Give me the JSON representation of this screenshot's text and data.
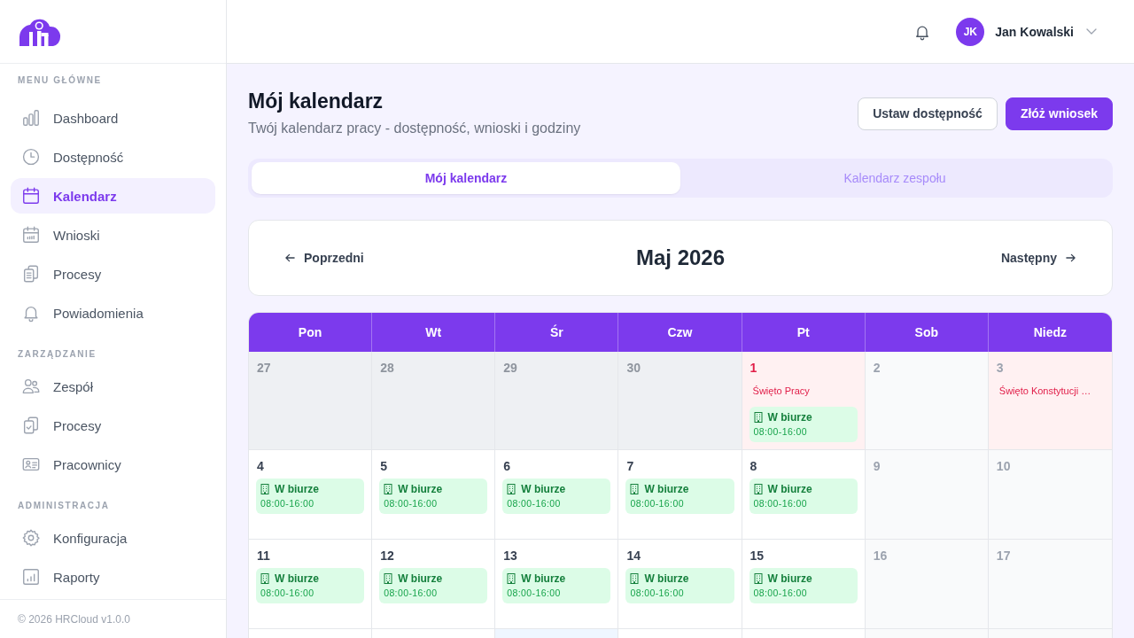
{
  "sidebar": {
    "sections": [
      {
        "title": "MENU GŁÓWNE",
        "items": [
          {
            "label": "Dashboard",
            "selected": false
          },
          {
            "label": "Dostępność",
            "selected": false
          },
          {
            "label": "Kalendarz",
            "selected": true
          },
          {
            "label": "Wnioski",
            "selected": false
          },
          {
            "label": "Procesy",
            "selected": false
          },
          {
            "label": "Powiadomienia",
            "selected": false
          }
        ]
      },
      {
        "title": "ZARZĄDZANIE",
        "items": [
          {
            "label": "Zespół",
            "selected": false
          },
          {
            "label": "Procesy",
            "selected": false
          },
          {
            "label": "Pracownicy",
            "selected": false
          }
        ]
      },
      {
        "title": "ADMINISTRACJA",
        "items": [
          {
            "label": "Konfiguracja",
            "selected": false
          },
          {
            "label": "Raporty",
            "selected": false
          }
        ]
      }
    ],
    "footer": "© 2026 HRCloud v1.0.0"
  },
  "top_bar": {
    "user": {
      "initials": "JK",
      "name": "Jan Kowalski"
    }
  },
  "page": {
    "title": "Mój kalendarz",
    "subtitle": "Twój kalendarz pracy - dostępność, wnioski i godziny",
    "buttons": [
      {
        "label": "Ustaw dostępność",
        "kind": "secondary"
      },
      {
        "label": "Złóż wniosek",
        "kind": "primary"
      }
    ]
  },
  "tabs": [
    {
      "label": "Mój kalendarz",
      "selected": true
    },
    {
      "label": "Kalendarz zespołu",
      "selected": false
    }
  ],
  "month_nav": {
    "previous": "Poprzedni",
    "title": "Maj 2026",
    "next": "Następny"
  },
  "calendar": {
    "weekdays": [
      "Pon",
      "Wt",
      "Śr",
      "Czw",
      "Pt",
      "Sob",
      "Niedz"
    ],
    "weeks": [
      [
        {
          "day": "27",
          "kind": "outside"
        },
        {
          "day": "28",
          "kind": "outside"
        },
        {
          "day": "29",
          "kind": "outside"
        },
        {
          "day": "30",
          "kind": "outside"
        },
        {
          "day": "1",
          "kind": "workday",
          "holiday": "Święto Pracy",
          "events": [
            {
              "title": "W biurze",
              "time": "08:00-16:00"
            }
          ]
        },
        {
          "day": "2",
          "kind": "weekend"
        },
        {
          "day": "3",
          "kind": "weekend",
          "holiday": "Święto Konstytucji …"
        }
      ],
      [
        {
          "day": "4",
          "kind": "workday",
          "events": [
            {
              "title": "W biurze",
              "time": "08:00-16:00"
            }
          ]
        },
        {
          "day": "5",
          "kind": "workday",
          "events": [
            {
              "title": "W biurze",
              "time": "08:00-16:00"
            }
          ]
        },
        {
          "day": "6",
          "kind": "workday",
          "events": [
            {
              "title": "W biurze",
              "time": "08:00-16:00"
            }
          ]
        },
        {
          "day": "7",
          "kind": "workday",
          "events": [
            {
              "title": "W biurze",
              "time": "08:00-16:00"
            }
          ]
        },
        {
          "day": "8",
          "kind": "workday",
          "events": [
            {
              "title": "W biurze",
              "time": "08:00-16:00"
            }
          ]
        },
        {
          "day": "9",
          "kind": "weekend"
        },
        {
          "day": "10",
          "kind": "weekend"
        }
      ],
      [
        {
          "day": "11",
          "kind": "workday",
          "events": [
            {
              "title": "W biurze",
              "time": "08:00-16:00"
            }
          ]
        },
        {
          "day": "12",
          "kind": "workday",
          "events": [
            {
              "title": "W biurze",
              "time": "08:00-16:00"
            }
          ]
        },
        {
          "day": "13",
          "kind": "workday",
          "events": [
            {
              "title": "W biurze",
              "time": "08:00-16:00"
            }
          ]
        },
        {
          "day": "14",
          "kind": "workday",
          "events": [
            {
              "title": "W biurze",
              "time": "08:00-16:00"
            }
          ]
        },
        {
          "day": "15",
          "kind": "workday",
          "events": [
            {
              "title": "W biurze",
              "time": "08:00-16:00"
            }
          ]
        },
        {
          "day": "16",
          "kind": "weekend"
        },
        {
          "day": "17",
          "kind": "weekend"
        }
      ],
      [
        {
          "kind": "workday"
        },
        {
          "kind": "workday"
        },
        {
          "kind": "today"
        },
        {
          "kind": "workday"
        },
        {
          "kind": "workday"
        },
        {
          "kind": "weekend"
        },
        {
          "kind": "weekend"
        }
      ]
    ]
  }
}
